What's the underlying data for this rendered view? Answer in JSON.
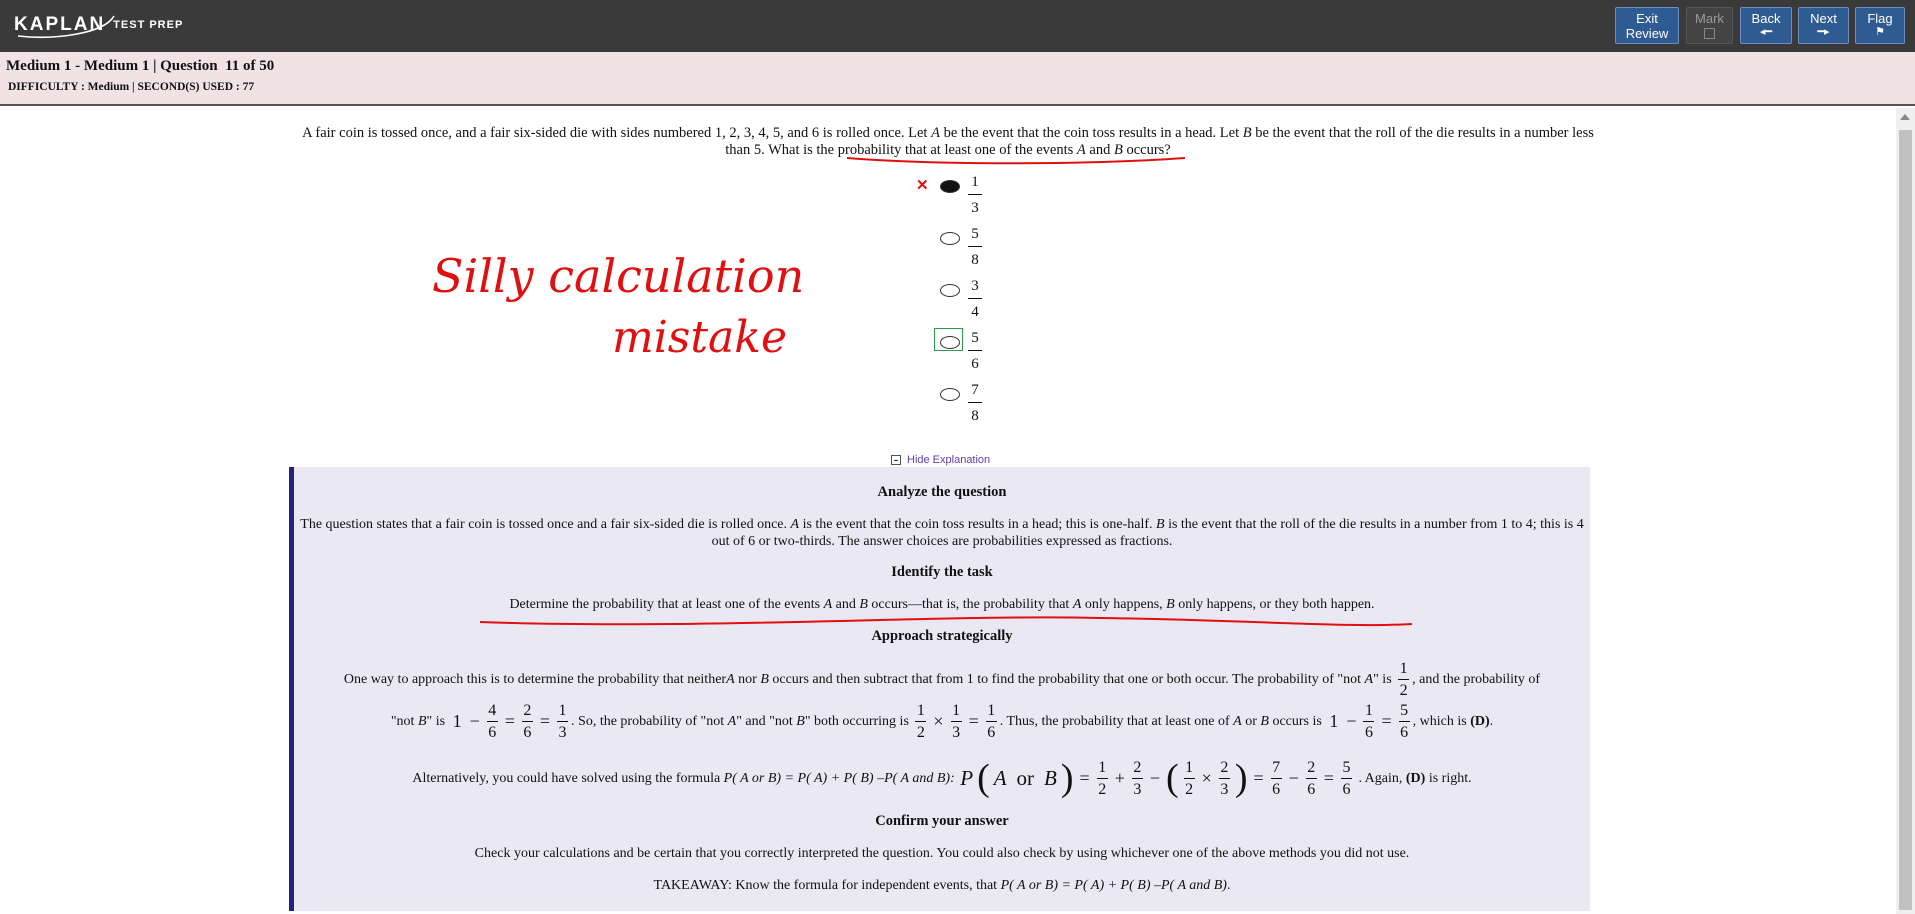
{
  "topbar": {
    "logo_main": "KAPLAN",
    "logo_sub": "TEST PREP",
    "buttons": {
      "exit_line1": "Exit",
      "exit_line2": "Review",
      "mark": "Mark",
      "back": "Back",
      "next": "Next",
      "flag": "Flag"
    }
  },
  "header": {
    "title": "Medium 1 - Medium 1 | Question  11 of 50",
    "meta": "DIFFICULTY : Medium | SECOND(S) USED : 77"
  },
  "question": {
    "p1": "A fair coin is tossed once, and a fair six-sided die with sides numbered 1, 2, 3, 4, 5, and 6 is rolled once. Let ",
    "var_a": "A",
    "p2": " be the event that the coin toss results in a head. Let ",
    "var_b": "B",
    "p3": " be the event that the roll of the die results in a number less than 5. What is the probability that at least one of the events ",
    "p4": " and ",
    "p5": " occurs?"
  },
  "choices": [
    {
      "num": "1",
      "den": "3",
      "selected": true,
      "incorrect": true
    },
    {
      "num": "5",
      "den": "8",
      "selected": false
    },
    {
      "num": "3",
      "den": "4",
      "selected": false
    },
    {
      "num": "5",
      "den": "6",
      "selected": false,
      "correct": true
    },
    {
      "num": "7",
      "den": "8",
      "selected": false
    }
  ],
  "hide_explanation": "Hide Explanation",
  "explanation": {
    "h_analyze": "Analyze the question",
    "analyze_1": "The question states that a fair coin is tossed once and a fair six-sided die is rolled once. ",
    "analyze_2": " is the event that the coin toss results in a head; this is one-half. ",
    "analyze_3": " is the event that the roll of the die results in a number from 1 to 4; this is 4 out of 6 or two-thirds. The answer choices are probabilities expressed as fractions.",
    "h_identify": "Identify the task",
    "identify_1": "Determine the probability that at least one of the events ",
    "identify_2": " and ",
    "identify_3": " occurs—that is, the probability that ",
    "identify_4": " only happens, ",
    "identify_5": " only happens, or they both happen.",
    "h_approach": "Approach strategically",
    "approach_1": "One way to approach this is to determine the probability that neither ",
    "approach_2": " nor ",
    "approach_3": " occurs and then subtract that from 1 to find the probability that one or both occur. The probability of \"not ",
    "approach_4": "\" is ",
    "approach_5": ", and the probability of",
    "approach_6": "\"not ",
    "approach_7": "\" is ",
    "approach_8": ". So, the probability of \"not ",
    "approach_9": "\" and \"not ",
    "approach_10": "\" both occurring is ",
    "approach_11": ". Thus, the probability that at least one of ",
    "approach_12": " or ",
    "approach_13": " occurs is ",
    "approach_14": ", which is ",
    "approach_ans": "(D)",
    "approach_end": ".",
    "alt_1": "Alternatively, you could have solved using the formula ",
    "alt_formula": "P( A or B) = P( A) + P( B) –P( A and B): ",
    "alt_2": " . Again, ",
    "alt_ans": "(D)",
    "alt_3": " is right.",
    "h_confirm": "Confirm your answer",
    "confirm": "Check your calculations and be certain that you correctly interpreted the question. You could also check by using whichever one of the above methods you did not use.",
    "takeaway_1": "TAKEAWAY: Know the formula for independent events, that ",
    "takeaway_formula": "P( A or B) = P( A) + P( B) –P( A and B)",
    "takeaway_2": ".",
    "math": {
      "one": "1",
      "two": "2",
      "three": "3",
      "four": "4",
      "five": "5",
      "six": "6",
      "seven": "7",
      "minus": "−",
      "equals": "=",
      "times": "×",
      "plus": "+",
      "P": "P",
      "A": "A",
      "or": "or",
      "B": "B",
      "lparen": "(",
      "rparen": ")"
    }
  },
  "handwriting": {
    "line1": "Silly calculation",
    "line2": "mistake"
  },
  "colors": {
    "topbar": "#3a3a3a",
    "button_blue": "#2f5b93",
    "header_pink": "#f1e2e6",
    "explanation_bg": "#eae9f3",
    "explanation_border": "#26227a",
    "annotation_red": "#e01010",
    "correct_green": "#2e9b4a",
    "link_purple": "#5d3fa0"
  }
}
